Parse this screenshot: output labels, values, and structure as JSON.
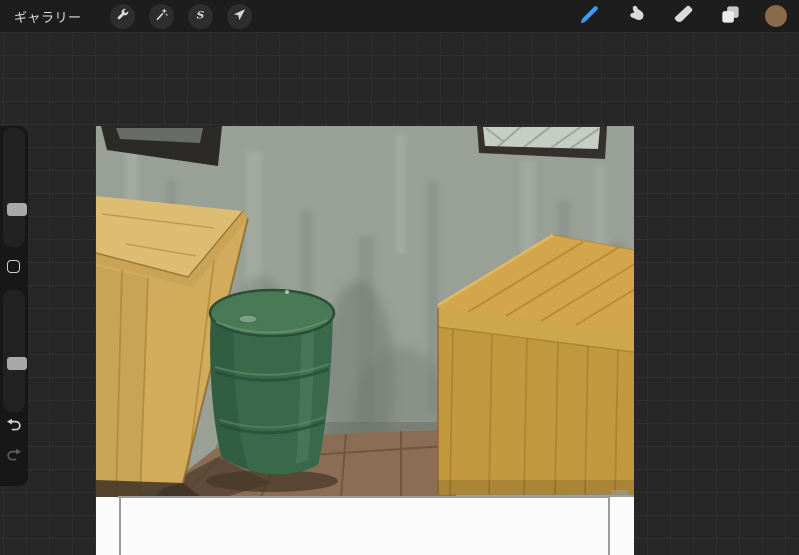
{
  "toolbar": {
    "bg": "#1D1D1D",
    "gallery_label": "ギャラリー",
    "left_tools": [
      "actions-wrench",
      "adjustments-wand",
      "selection-s",
      "transform-arrow"
    ],
    "right_tools": [
      "paint-brush",
      "smudge-finger",
      "eraser",
      "layers",
      "color-swatch"
    ],
    "active_tool": "paint-brush",
    "accent_color": "#3E9BF7",
    "icon_color": "#D9D9D9",
    "current_color_swatch": "#8A6A4A",
    "selection_letter": "S"
  },
  "sidebar": {
    "controls": [
      "brush-size-slider",
      "modify-button",
      "opacity-slider",
      "undo-button",
      "redo-button"
    ],
    "undo_color": "#D4D4D4",
    "redo_color": "#5E5E5E"
  },
  "workspace": {
    "background_color": "#272727",
    "grid_line_color": "rgba(255,255,255,0.035)"
  },
  "canvas": {
    "page_color": "#FBFBFB",
    "panel_border_color": "#9B9B9B",
    "painting": {
      "description": "storage room scene: two wooden crates, green oil drum, framed pictures on grey wall",
      "wall": "#99A096",
      "wall_shadow": "#6F7870",
      "floor": "#8A6D54",
      "floor_shadow": "#4F3D2F",
      "crate_top_left": "#DCBD72",
      "crate_front_left": "#D2AB5C",
      "crate_rim_left": "#C9A455",
      "crate_top_right": "#D4A64C",
      "crate_front_right": "#C2983F",
      "crate_rim_right": "#CDA74B",
      "barrel_top": "#497A55",
      "barrel_body": "#3A684A",
      "barrel_dark": "#2C5038",
      "frame_dark": "#2B2A27",
      "window_frame": "#352F2D",
      "glass": "#C6CDC5"
    }
  }
}
